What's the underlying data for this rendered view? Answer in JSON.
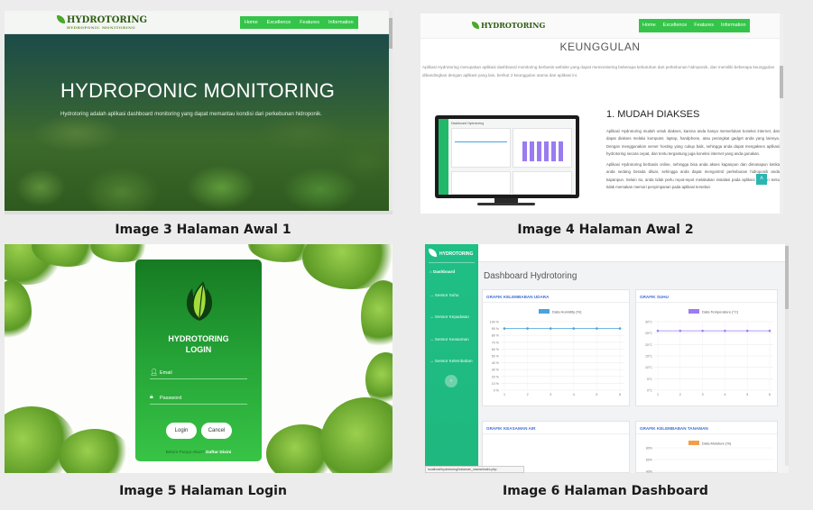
{
  "captions": {
    "c1": "Image 3 Halaman Awal 1",
    "c2": "Image 4 Halaman Awal 2",
    "c3": "Image 5 Halaman Login",
    "c4": "Image 6 Halaman Dashboard"
  },
  "landing1": {
    "logo_text": "HYDROTORING",
    "logo_tagline": "HYDROPONIC MONITORING",
    "menu": [
      "Home",
      "Excellence",
      "Features",
      "Information"
    ],
    "hero_title": "HYDROPONIC MONITORING",
    "hero_subtitle": "Hydrotoring adalah aplikasi dashboard monitoring yang dapat memantau kondisi dari perkebunan hidroponik."
  },
  "landing2": {
    "logo_text": "HYDROTORING",
    "menu": [
      "Home",
      "Excellence",
      "Features",
      "Information"
    ],
    "section_title": "KEUNGGULAN",
    "intro": "Aplikasi Hydrotoring merupakan aplikasi dashboard monitoring berbasis website yang dapat memonitoring beberapa kebutuhan dari perkebunan hidroponik, dan memiliki beberapa keunggulan dibandingkan dengan aplikasi yang lain, berikut 2 keunggulan utama dari aplikasi ini.",
    "feature_title": "1. MUDAH DIAKSES",
    "feature_p1": "Aplikasi Hydrotoring mudah untuk diakses, karena anda hanya memerlukan koneksi internet, dan dapat diakses melalui komputer, laptop, handphone, atau perangkat gadget anda yang lainnya. Dengan menggunakan server hosting yang cukup baik, sehingga anda dapat mengakses aplikasi hydrotoring secara cepat, dan tentu tergantung juga koneksi internet yang anda gunakan.",
    "feature_p2": "Aplikasi Hydrotoring berbasis online, sehingga bisa anda akses kapanpun dan dimanapun ketika anda sedang berada diluar, sehingga anda dapat mengontrol perkebunan hidroponik anda kapanpun. Selain itu, anda tidak perlu repot-repot melakukan instalasi pada aplikasi ini, dan tentu tidak memakan memori penyimpanan pada aplikasi tersebut.",
    "monitor_title": "Dashboard Hydrotoring",
    "to_top_icon": "chevron-up-icon"
  },
  "login": {
    "title_line1": "HYDROTORING",
    "title_line2": "LOGIN",
    "email_placeholder": "Email",
    "password_placeholder": "Password",
    "login_button": "Login",
    "cancel_button": "Cancel",
    "signup_text": "Belum Punya Akun?",
    "signup_link": "Daftar Disini"
  },
  "dashboard": {
    "brand": "HYDROTORING",
    "nav": [
      "Dashboard",
      "Sensor Suhu",
      "Sensor Kepadatan",
      "Sensor Keasaman",
      "Sensor Kelembaban"
    ],
    "title": "Dashboard Hydrotoring",
    "status_url": "localhost/hydrotoring/halaman_utama/index.php",
    "cards": {
      "humidity": "GRAFIK KELEMBABAN UDARA",
      "temp": "GRAFIK SUHU",
      "ph": "GRAFIK KEASAMAN AIR",
      "soil": "GRAFIK KELEMBABAN TANAMAN"
    }
  },
  "chart_data": [
    {
      "type": "line",
      "title": "GRAFIK KELEMBABAN UDARA",
      "series": [
        {
          "name": "Data Humidity (%)",
          "values": [
            90,
            90,
            90,
            90,
            90,
            90
          ]
        }
      ],
      "x": [
        1,
        2,
        3,
        4,
        5,
        6
      ],
      "y_ticks": [
        "100 %",
        "90 %",
        "80 %",
        "70 %",
        "60 %",
        "50 %",
        "40 %",
        "30 %",
        "20 %",
        "10 %",
        "0 %"
      ],
      "ylim": [
        0,
        100
      ],
      "color": "#4aa3df"
    },
    {
      "type": "line",
      "title": "GRAFIK SUHU",
      "series": [
        {
          "name": "Data Temperature (°C)",
          "values": [
            26,
            26,
            26,
            26,
            26,
            26
          ]
        }
      ],
      "x": [
        1,
        2,
        3,
        4,
        5,
        6
      ],
      "y_ticks": [
        "30°C",
        "25°C",
        "20°C",
        "15°C",
        "10°C",
        "5°C",
        "0°C"
      ],
      "ylim": [
        0,
        30
      ],
      "color": "#9b7cf2"
    },
    {
      "type": "line",
      "title": "GRAFIK KELEMBABAN TANAMAN",
      "series": [
        {
          "name": "Data Moisture (%)",
          "values": []
        }
      ],
      "y_ticks": [
        "80%",
        "60%",
        "40%"
      ],
      "color": "#f0a04b"
    }
  ]
}
